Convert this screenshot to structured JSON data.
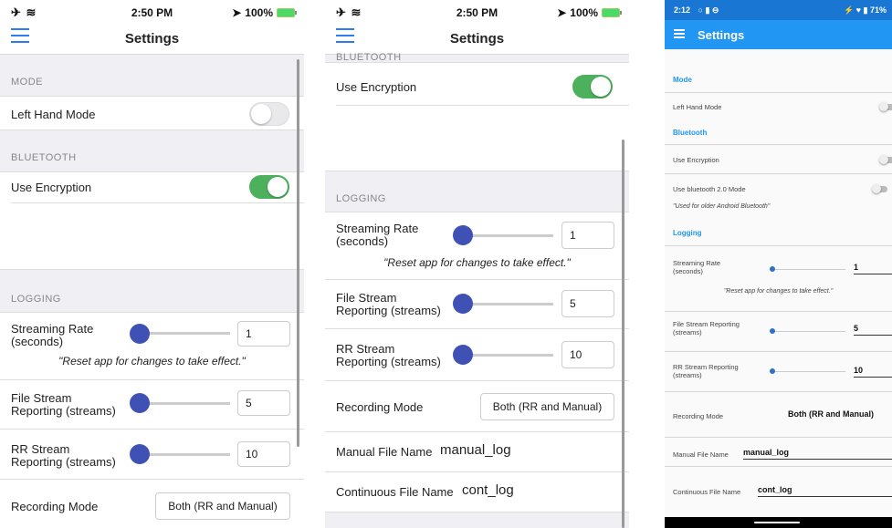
{
  "ios_status": {
    "time": "2:50 PM",
    "battery": "100%",
    "left_icons": "✈ ≋",
    "location_icon": "➤"
  },
  "screen1": {
    "title": "Settings",
    "sections": {
      "mode": "MODE",
      "bluetooth": "BLUETOOTH",
      "logging": "LOGGING"
    },
    "left_hand_mode": {
      "label": "Left Hand Mode",
      "on": false
    },
    "use_encryption": {
      "label": "Use Encryption",
      "on": true
    },
    "streaming_rate": {
      "label": "Streaming Rate (seconds)",
      "value": "1"
    },
    "reset_note": "\"Reset app for changes to take effect.\"",
    "file_stream": {
      "label": "File Stream Reporting (streams)",
      "value": "5"
    },
    "rr_stream": {
      "label": "RR Stream Reporting (streams)",
      "value": "10"
    },
    "recording_mode": {
      "label": "Recording Mode",
      "value": "Both (RR and Manual)"
    }
  },
  "screen2": {
    "title": "Settings",
    "sections": {
      "bluetooth": "BLUETOOTH",
      "logging": "LOGGING"
    },
    "use_encryption": {
      "label": "Use Encryption",
      "on": true
    },
    "streaming_rate": {
      "label": "Streaming Rate (seconds)",
      "value": "1"
    },
    "reset_note": "\"Reset app for changes to take effect.\"",
    "file_stream": {
      "label": "File Stream Reporting (streams)",
      "value": "5"
    },
    "rr_stream": {
      "label": "RR Stream Reporting (streams)",
      "value": "10"
    },
    "recording_mode": {
      "label": "Recording Mode",
      "value": "Both (RR and Manual)"
    },
    "manual_file": {
      "label": "Manual File Name",
      "value": "manual_log"
    },
    "cont_file": {
      "label": "Continuous File Name",
      "value": "cont_log"
    }
  },
  "android_status": {
    "time": "2:12",
    "battery": "71%",
    "left_icons": "○ ▮ ⊖",
    "right_icons": "⚡ ♥ ▮"
  },
  "screen3": {
    "title": "Settings",
    "sections": {
      "mode": "Mode",
      "bluetooth": "Bluetooth",
      "logging": "Logging"
    },
    "left_hand_mode": {
      "label": "Left Hand Mode",
      "on": false
    },
    "use_encryption": {
      "label": "Use Encryption",
      "on": false
    },
    "bt2_mode": {
      "label": "Use bluetooth 2.0 Mode",
      "on": false,
      "note": "\"Used for older Android Bluetooth\""
    },
    "streaming_rate": {
      "label": "Streaming Rate (seconds)",
      "value": "1"
    },
    "reset_note": "\"Reset app for changes to take effect.\"",
    "file_stream": {
      "label": "File Stream Reporting (streams)",
      "value": "5"
    },
    "rr_stream": {
      "label": "RR Stream Reporting (streams)",
      "value": "10"
    },
    "recording_mode": {
      "label": "Recording Mode",
      "value": "Both (RR and Manual)"
    },
    "manual_file": {
      "label": "Manual File Name",
      "value": "manual_log"
    },
    "cont_file": {
      "label": "Continuous File Name",
      "value": "cont_log"
    }
  },
  "colors": {
    "ios_accent": "#2f7bf6",
    "switch_on": "#4cb05c",
    "android_primary": "#2196f3",
    "slider_thumb": "#3f51b5"
  }
}
